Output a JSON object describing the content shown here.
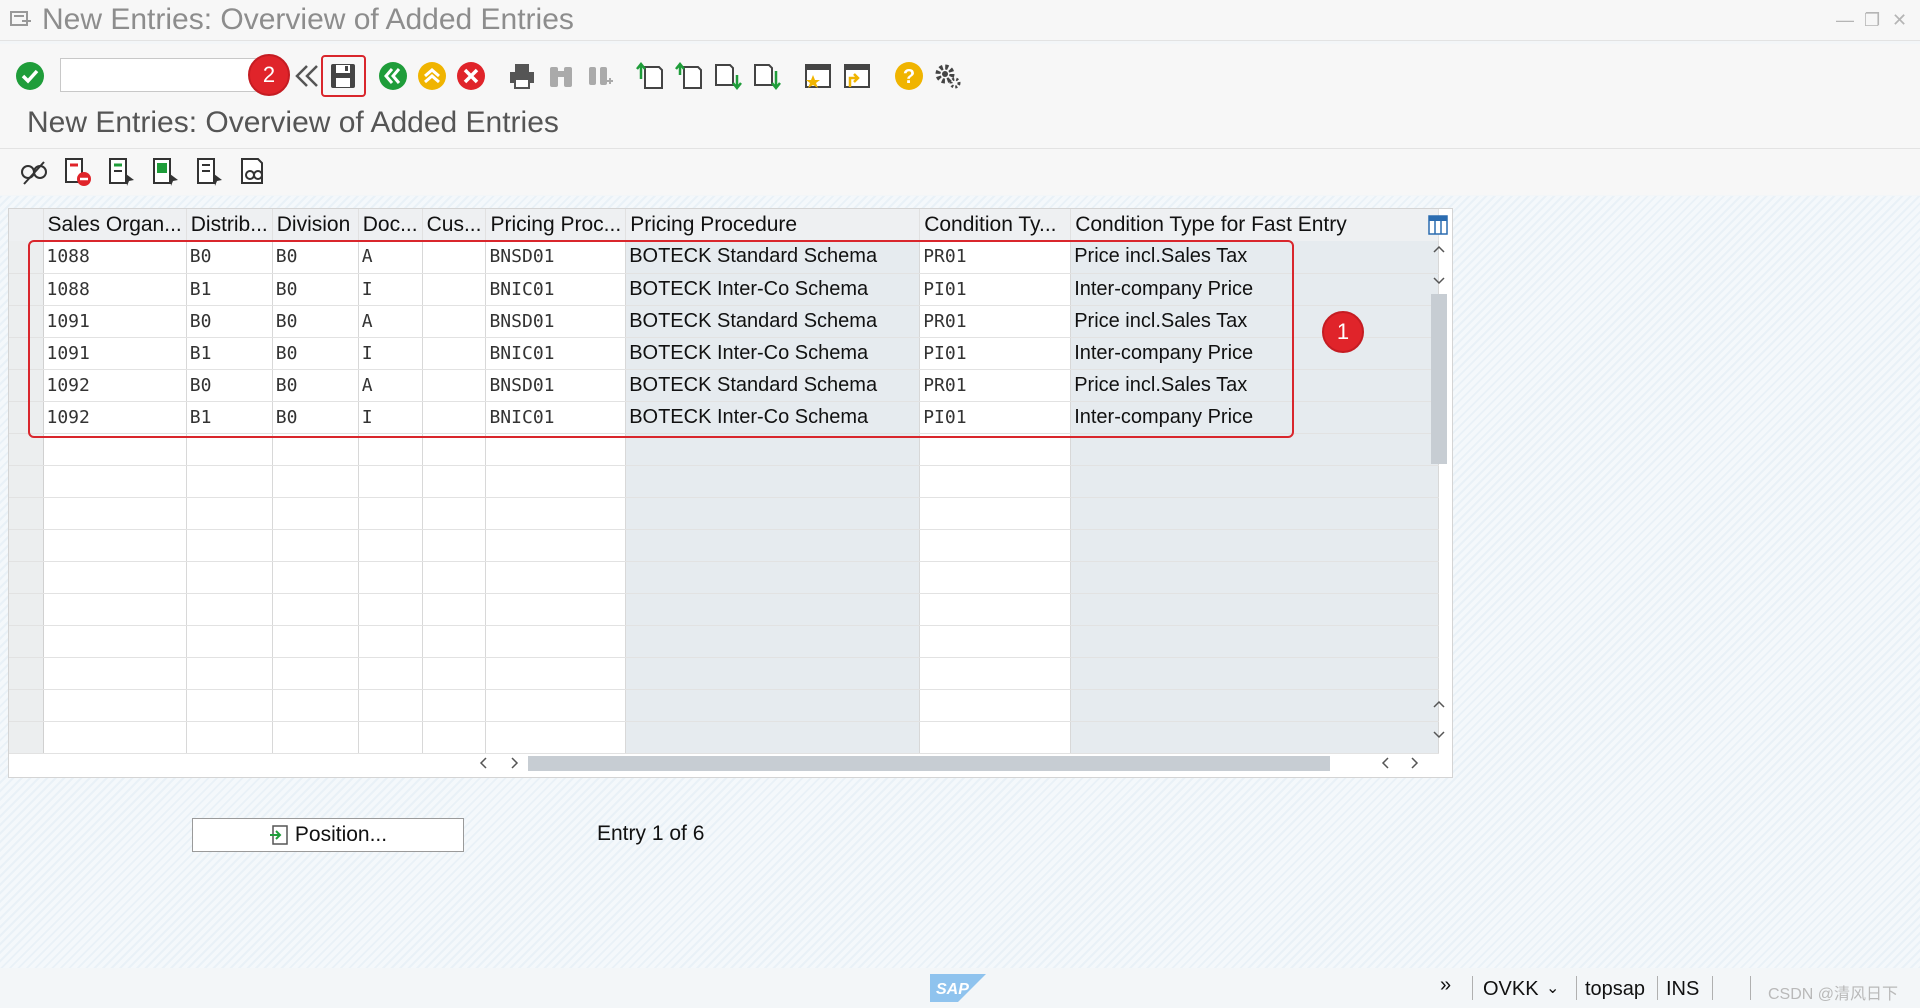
{
  "window": {
    "title": "New Entries: Overview of Added Entries"
  },
  "toolbar": {
    "command_value": "",
    "badge2": "2"
  },
  "page": {
    "title": "New Entries: Overview of Added Entries"
  },
  "grid": {
    "columns": [
      "Sales Organ...",
      "Distrib...",
      "Division",
      "Doc...",
      "Cus...",
      "Pricing Proc...",
      "Pricing Procedure",
      "Condition Ty...",
      "Condition Type for Fast Entry"
    ],
    "rows": [
      [
        "1088",
        "B0",
        "B0",
        "A",
        "",
        "BNSD01",
        "BOTECK Standard Schema",
        "PR01",
        "Price incl.Sales Tax"
      ],
      [
        "1088",
        "B1",
        "B0",
        "I",
        "",
        "BNIC01",
        "BOTECK Inter-Co Schema",
        "PI01",
        "Inter-company Price"
      ],
      [
        "1091",
        "B0",
        "B0",
        "A",
        "",
        "BNSD01",
        "BOTECK Standard Schema",
        "PR01",
        "Price incl.Sales Tax"
      ],
      [
        "1091",
        "B1",
        "B0",
        "I",
        "",
        "BNIC01",
        "BOTECK Inter-Co Schema",
        "PI01",
        "Inter-company Price"
      ],
      [
        "1092",
        "B0",
        "B0",
        "A",
        "",
        "BNSD01",
        "BOTECK Standard Schema",
        "PR01",
        "Price incl.Sales Tax"
      ],
      [
        "1092",
        "B1",
        "B0",
        "I",
        "",
        "BNIC01",
        "BOTECK Inter-Co Schema",
        "PI01",
        "Inter-company Price"
      ]
    ],
    "badge1": "1"
  },
  "footer": {
    "position_label": "Position...",
    "entry_info": "Entry 1 of 6"
  },
  "status": {
    "transaction": "OVKK",
    "system": "topsap",
    "mode": "INS",
    "watermark": "CSDN @清风日下"
  },
  "colors": {
    "accent_red": "#d9262c",
    "ok_green": "#1f9d3a",
    "yellow": "#f0b400"
  }
}
